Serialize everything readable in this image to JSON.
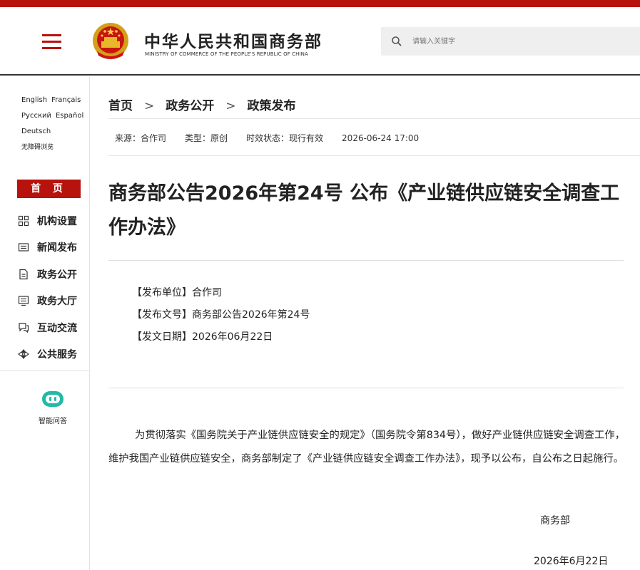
{
  "header": {
    "title": "中华人民共和国商务部",
    "subtitle": "MINISTRY OF COMMERCE OF THE PEOPLE'S REPUBLIC OF CHINA",
    "search_placeholder": "请输入关键字",
    "brand_color": "#b8120c"
  },
  "sidebar": {
    "languages": {
      "english": "English",
      "french": "Français",
      "russian": "Русский",
      "spanish": "Español",
      "german": "Deutsch",
      "accessibility": "无障碍浏览"
    },
    "home": "首 页",
    "nav": [
      {
        "label": "机构设置",
        "icon": "org-grid-icon"
      },
      {
        "label": "新闻发布",
        "icon": "news-icon"
      },
      {
        "label": "政务公开",
        "icon": "document-icon"
      },
      {
        "label": "政务大厅",
        "icon": "hall-icon"
      },
      {
        "label": "互动交流",
        "icon": "chat-icon"
      },
      {
        "label": "公共服务",
        "icon": "service-icon"
      }
    ],
    "ai_label": "智能问答"
  },
  "breadcrumb": {
    "home": "首页",
    "section": "政务公开",
    "current": "政策发布",
    "separator": ">"
  },
  "meta": {
    "source": "来源：合作司",
    "type": "类型：原创",
    "status": "时效状态：现行有效",
    "datetime": "2026-06-24 17:00"
  },
  "article": {
    "title": "商务部公告2026年第24号 公布《产业链供应链安全调查工作办法》",
    "issuer": "【发布单位】合作司",
    "doc_number": "【发布文号】商务部公告2026年第24号",
    "issue_date": "【发文日期】2026年06月22日",
    "body": "为贯彻落实《国务院关于产业链供应链安全的规定》（国务院令第834号），做好产业链供应链安全调查工作，维护我国产业链供应链安全，商务部制定了《产业链供应链安全调查工作办法》，现予以公布，自公布之日起施行。",
    "signer": "商务部",
    "date": "2026年6月22日"
  }
}
